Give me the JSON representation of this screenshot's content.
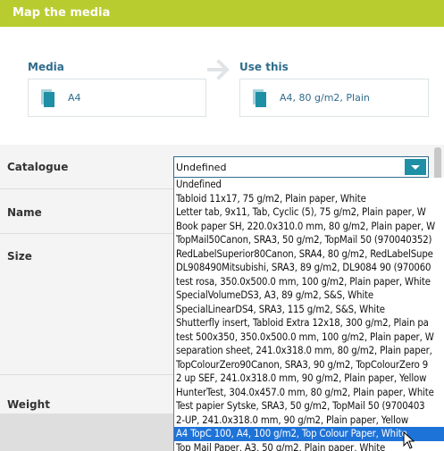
{
  "header": {
    "title": "Map the media"
  },
  "mapping": {
    "media_label": "Media",
    "media_value": "A4",
    "use_label": "Use this",
    "use_value": "A4, 80 g/m2, Plain"
  },
  "form": {
    "catalogue_label": "Catalogue",
    "name_label": "Name",
    "size_label": "Size",
    "weight_label": "Weight",
    "catalogue_selected": "Undefined"
  },
  "dropdown": {
    "options": [
      "Undefined",
      "Tabloid 11x17, 75 g/m2, Plain paper, White",
      "Letter tab, 9x11, Tab, Cyclic (5), 75 g/m2, Plain paper, W",
      "Book paper SH, 220.0x310.0 mm, 80 g/m2, Plain paper, W",
      "TopMail50Canon, SRA3, 50 g/m2, TopMail 50 (970040352)",
      "RedLabelSuperior80Canon, SRA4, 80 g/m2, RedLabelSupe",
      "DL908490Mitsubishi, SRA3, 89 g/m2, DL9084 90 (970060",
      "test rosa, 350.0x500.0 mm, 100 g/m2, Plain paper, White",
      "SpecialVolumeDS3, A3, 89 g/m2, S&S, White",
      "SpecialLinearDS4, SRA3, 115 g/m2, S&S, White",
      "Shutterfly insert, Tabloid Extra 12x18, 300 g/m2, Plain pa",
      "test 500x350, 350.0x500.0 mm, 100 g/m2, Plain paper, W",
      "separation sheet, 241.0x318.0 mm, 80 g/m2, Plain paper,",
      "TopColourZero90Canon, SRA3, 90 g/m2, TopColourZero 9",
      "2 up SEF, 241.0x318.0 mm, 90 g/m2, Plain paper, Yellow",
      "HunterTest, 304.0x457.0 mm, 80 g/m2, Plain paper, White",
      "Test papier Sytske, SRA3, 50 g/m2, TopMail 50 (9700403",
      "2-UP, 241.0x318.0 mm, 90 g/m2, Plain paper, Yellow",
      "A4 TopC 100, A4, 100 g/m2, Top Colour Paper, White",
      "Top Mail Paper, A3, 50 g/m2, Plain paper, White"
    ],
    "selected_index": 18
  },
  "colors": {
    "header_bg": "#b9cc2f",
    "accent": "#1f8fa5",
    "label_blue": "#2f6c8c",
    "selection": "#1e73d8"
  },
  "icons": {
    "media_icon": "document-stack-icon",
    "arrow": "arrow-right-icon",
    "dropdown_toggle": "chevron-down-icon",
    "cursor": "mouse-pointer-icon"
  }
}
